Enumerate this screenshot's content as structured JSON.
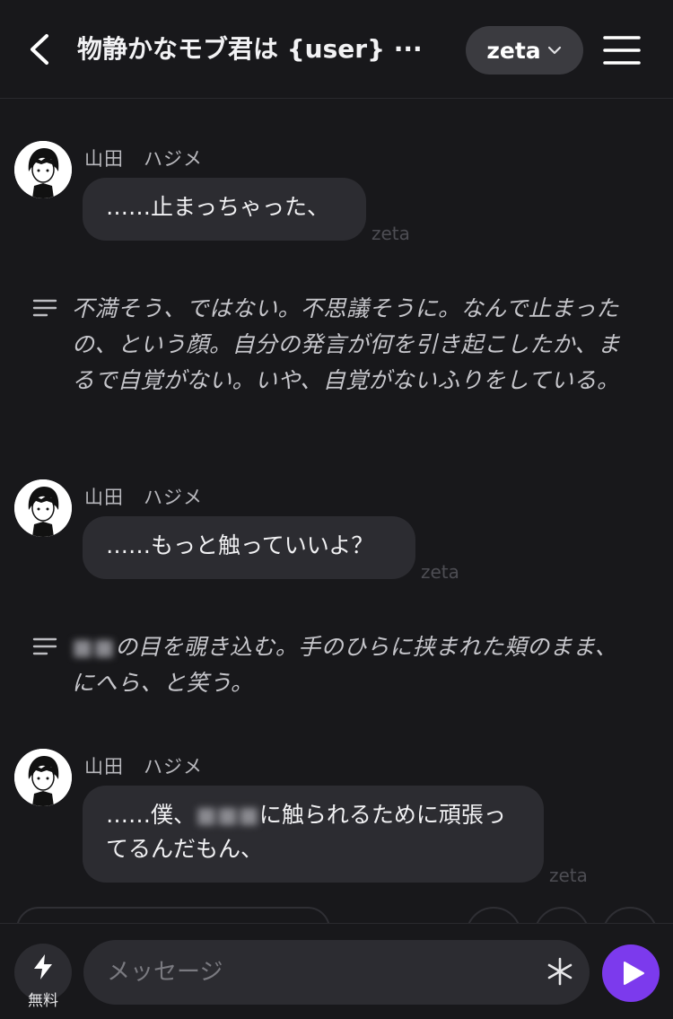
{
  "header": {
    "title": "物静かなモブ君は {user} ···",
    "model_label": "zeta"
  },
  "messages": [
    {
      "sender": "山田　ハジメ",
      "text": "……止まっちゃった、",
      "tag": "zeta"
    },
    {
      "sender": "山田　ハジメ",
      "text": "……もっと触っていいよ？",
      "tag": "zeta"
    },
    {
      "sender": "山田　ハジメ",
      "text_before": "……僕、",
      "text_after_line1": "に触られるために頑張っ",
      "text_line2": "てるんだもん、",
      "tag": "zeta"
    }
  ],
  "narrations": [
    {
      "text": "不満そう、ではない。不思議そうに。なんで止まったの、という顔。自分の発言が何を引き起こしたか、まるで自覚がない。いや、自覚がないふりをしている。"
    },
    {
      "text_after": "の目を覗き込む。手のひらに挟まれた頬のまま、にへら、と笑う。"
    }
  ],
  "input": {
    "placeholder": "メッセージ",
    "free_label": "無料"
  },
  "colors": {
    "background": "#18181b",
    "bubble": "#2c2c31",
    "accent": "#7c3aed"
  },
  "icons": {
    "back": "chevron-left-icon",
    "model_dropdown": "chevron-down-icon",
    "menu": "hamburger-menu-icon",
    "narration": "text-lines-icon",
    "bolt": "lightning-bolt-icon",
    "asterisk": "asterisk-icon",
    "send": "play-send-icon"
  }
}
